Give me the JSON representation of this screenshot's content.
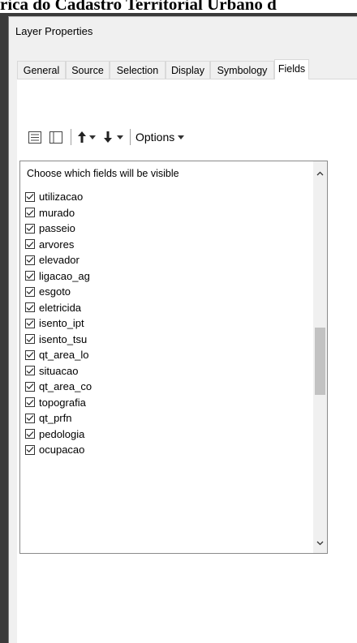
{
  "background": {
    "title": "rica do Cadastro Territorial Urbano d"
  },
  "dialog": {
    "title": "Layer Properties"
  },
  "tabs": [
    {
      "label": "General"
    },
    {
      "label": "Source"
    },
    {
      "label": "Selection"
    },
    {
      "label": "Display"
    },
    {
      "label": "Symbology"
    },
    {
      "label": "Fields"
    }
  ],
  "active_tab": "Fields",
  "toolbar": {
    "options_label": "Options"
  },
  "fields": {
    "header": "Choose which fields will be visible",
    "items": [
      {
        "name": "utilizacao",
        "checked": true
      },
      {
        "name": "murado",
        "checked": true
      },
      {
        "name": "passeio",
        "checked": true
      },
      {
        "name": "arvores",
        "checked": true
      },
      {
        "name": "elevador",
        "checked": true
      },
      {
        "name": "ligacao_ag",
        "checked": true
      },
      {
        "name": "esgoto",
        "checked": true
      },
      {
        "name": "eletricida",
        "checked": true
      },
      {
        "name": "isento_ipt",
        "checked": true
      },
      {
        "name": "isento_tsu",
        "checked": true
      },
      {
        "name": "qt_area_lo",
        "checked": true
      },
      {
        "name": "situacao",
        "checked": true
      },
      {
        "name": "qt_area_co",
        "checked": true
      },
      {
        "name": "topografia",
        "checked": true
      },
      {
        "name": "qt_prfn",
        "checked": true
      },
      {
        "name": "pedologia",
        "checked": true
      },
      {
        "name": "ocupacao",
        "checked": true
      }
    ]
  },
  "colors": {
    "panel_bg": "#ffffff",
    "dialog_bg": "#f0f0f0",
    "scroll_thumb": "#c2c2c2"
  }
}
